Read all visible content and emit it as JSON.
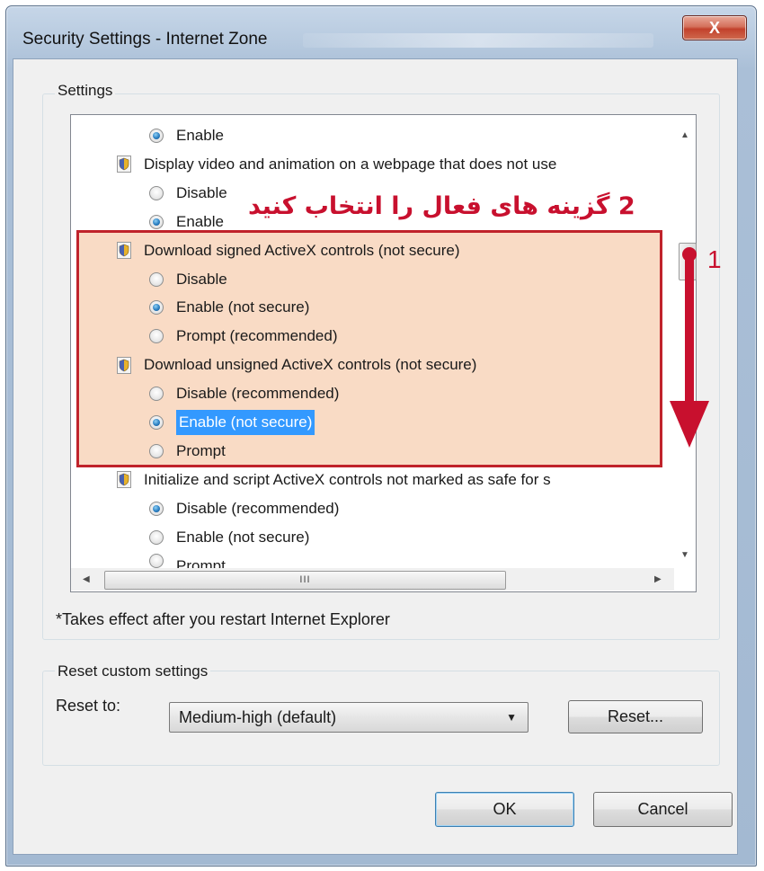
{
  "window": {
    "title": "Security Settings - Internet Zone",
    "close_glyph": "X"
  },
  "settings": {
    "group_label": "Settings",
    "rows": [
      {
        "kind": "radio",
        "label": "Enable",
        "checked": true
      },
      {
        "kind": "heading",
        "label": "Display video and animation on a webpage that does not use"
      },
      {
        "kind": "radio",
        "label": "Disable",
        "checked": false
      },
      {
        "kind": "radio",
        "label": "Enable",
        "checked": true
      },
      {
        "kind": "heading",
        "label": "Download signed ActiveX controls (not secure)"
      },
      {
        "kind": "radio",
        "label": "Disable",
        "checked": false
      },
      {
        "kind": "radio",
        "label": "Enable (not secure)",
        "checked": true
      },
      {
        "kind": "radio",
        "label": "Prompt (recommended)",
        "checked": false
      },
      {
        "kind": "heading",
        "label": "Download unsigned ActiveX controls (not secure)"
      },
      {
        "kind": "radio",
        "label": "Disable (recommended)",
        "checked": false
      },
      {
        "kind": "radio",
        "label": "Enable (not secure)",
        "checked": true,
        "selected": true
      },
      {
        "kind": "radio",
        "label": "Prompt",
        "checked": false
      },
      {
        "kind": "heading",
        "label": "Initialize and script ActiveX controls not marked as safe for s"
      },
      {
        "kind": "radio",
        "label": "Disable (recommended)",
        "checked": true
      },
      {
        "kind": "radio",
        "label": "Enable (not secure)",
        "checked": false
      },
      {
        "kind": "radio",
        "label": "Prompt",
        "checked": false
      }
    ],
    "hscroll_grip": "III",
    "note": "*Takes effect after you restart Internet Explorer"
  },
  "annotations": {
    "step2_text": "2 گزینه های فعال را انتخاب کنید",
    "step1_text": "1",
    "color": "#c8102e"
  },
  "reset": {
    "group_label": "Reset custom settings",
    "reset_to_label": "Reset to:",
    "selected_value": "Medium-high (default)",
    "reset_button": "Reset..."
  },
  "footer": {
    "ok_button": "OK",
    "cancel_button": "Cancel"
  }
}
